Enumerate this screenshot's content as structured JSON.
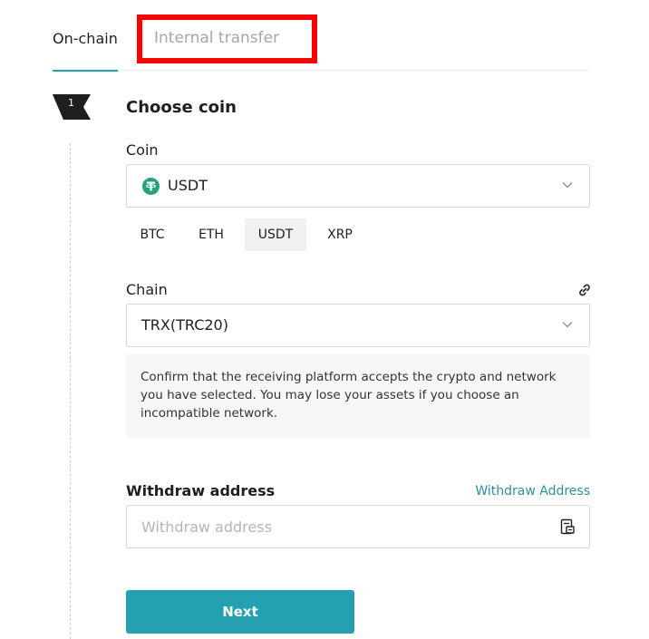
{
  "tabs": [
    {
      "label": "On-chain",
      "active": true
    },
    {
      "label": "Internal transfer",
      "active": false
    }
  ],
  "step": {
    "number": "1",
    "title": "Choose coin"
  },
  "coin": {
    "label": "Coin",
    "selected": "USDT",
    "icon": "tether-icon",
    "icon_color": "#26a17b",
    "quick_options": [
      "BTC",
      "ETH",
      "USDT",
      "XRP"
    ],
    "quick_selected": "USDT"
  },
  "chain": {
    "label": "Chain",
    "selected": "TRX(TRC20)",
    "notice": "Confirm that the receiving platform accepts the crypto and network you have selected. You may lose your assets if you choose an incompatible network."
  },
  "withdraw": {
    "label": "Withdraw address",
    "link": "Withdraw Address",
    "placeholder": "Withdraw address",
    "value": ""
  },
  "actions": {
    "next_label": "Next"
  },
  "colors": {
    "accent": "#24a0b0",
    "highlight_box": "#ff0000",
    "tether": "#26a17b"
  }
}
